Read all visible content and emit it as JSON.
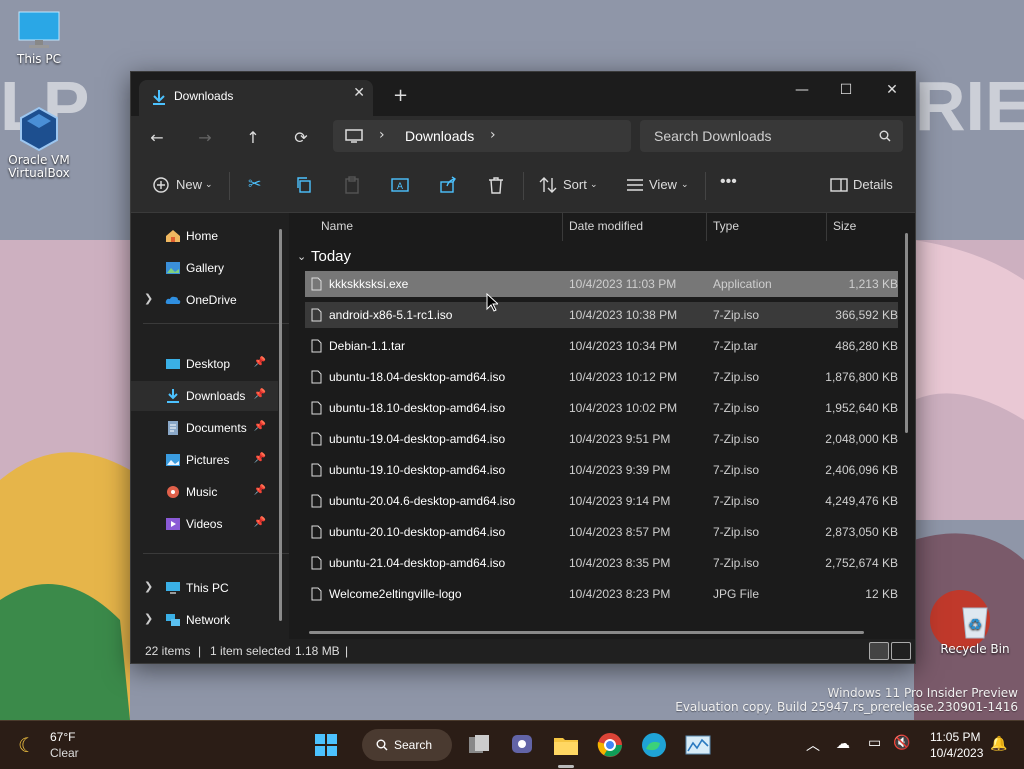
{
  "desktop": {
    "icons": [
      {
        "label": "This PC"
      },
      {
        "label": "Oracle VM VirtualBox"
      },
      {
        "label": "Recycle Bin"
      }
    ],
    "watermark_line1": "Windows 11 Pro Insider Preview",
    "watermark_line2": "Evaluation copy. Build 25947.rs_prerelease.230901-1416"
  },
  "window": {
    "tab_title": "Downloads",
    "address": {
      "location": "Downloads"
    },
    "search": {
      "placeholder": "Search Downloads"
    },
    "toolbar": {
      "new_label": "New",
      "sort_label": "Sort",
      "view_label": "View",
      "details_label": "Details"
    },
    "nav": {
      "items": [
        {
          "label": "Home",
          "icon": "home-icon"
        },
        {
          "label": "Gallery",
          "icon": "gallery-icon"
        },
        {
          "label": "OneDrive",
          "icon": "cloud-icon"
        },
        {
          "label": "Desktop",
          "icon": "desktop-icon"
        },
        {
          "label": "Downloads",
          "icon": "download-icon"
        },
        {
          "label": "Documents",
          "icon": "document-icon"
        },
        {
          "label": "Pictures",
          "icon": "picture-icon"
        },
        {
          "label": "Music",
          "icon": "music-icon"
        },
        {
          "label": "Videos",
          "icon": "video-icon"
        },
        {
          "label": "This PC",
          "icon": "computer-icon"
        },
        {
          "label": "Network",
          "icon": "network-icon"
        }
      ]
    },
    "columns": {
      "name": "Name",
      "date": "Date modified",
      "type": "Type",
      "size": "Size"
    },
    "group_label": "Today",
    "files": [
      {
        "name": "kkkskksksi.exe",
        "date": "10/4/2023 11:03 PM",
        "type": "Application",
        "size": "1,213 KB"
      },
      {
        "name": "android-x86-5.1-rc1.iso",
        "date": "10/4/2023 10:38 PM",
        "type": "7-Zip.iso",
        "size": "366,592 KB"
      },
      {
        "name": "Debian-1.1.tar",
        "date": "10/4/2023 10:34 PM",
        "type": "7-Zip.tar",
        "size": "486,280 KB"
      },
      {
        "name": "ubuntu-18.04-desktop-amd64.iso",
        "date": "10/4/2023 10:12 PM",
        "type": "7-Zip.iso",
        "size": "1,876,800 KB"
      },
      {
        "name": "ubuntu-18.10-desktop-amd64.iso",
        "date": "10/4/2023 10:02 PM",
        "type": "7-Zip.iso",
        "size": "1,952,640 KB"
      },
      {
        "name": "ubuntu-19.04-desktop-amd64.iso",
        "date": "10/4/2023 9:51 PM",
        "type": "7-Zip.iso",
        "size": "2,048,000 KB"
      },
      {
        "name": "ubuntu-19.10-desktop-amd64.iso",
        "date": "10/4/2023 9:39 PM",
        "type": "7-Zip.iso",
        "size": "2,406,096 KB"
      },
      {
        "name": "ubuntu-20.04.6-desktop-amd64.iso",
        "date": "10/4/2023 9:14 PM",
        "type": "7-Zip.iso",
        "size": "4,249,476 KB"
      },
      {
        "name": "ubuntu-20.10-desktop-amd64.iso",
        "date": "10/4/2023 8:57 PM",
        "type": "7-Zip.iso",
        "size": "2,873,050 KB"
      },
      {
        "name": "ubuntu-21.04-desktop-amd64.iso",
        "date": "10/4/2023 8:35 PM",
        "type": "7-Zip.iso",
        "size": "2,752,674 KB"
      },
      {
        "name": "Welcome2eltingville-logo",
        "date": "10/4/2023 8:23 PM",
        "type": "JPG File",
        "size": "12 KB"
      }
    ],
    "status": {
      "item_count": "22 items",
      "selected": "1 item selected",
      "selected_size": "1.18 MB"
    }
  },
  "taskbar": {
    "weather_temp": "67°F",
    "weather_desc": "Clear",
    "search_label": "Search",
    "time": "11:05 PM",
    "date": "10/4/2023"
  },
  "colors": {
    "accent": "#4cc2ff",
    "selection": "#777777",
    "window_bg": "#202020"
  }
}
